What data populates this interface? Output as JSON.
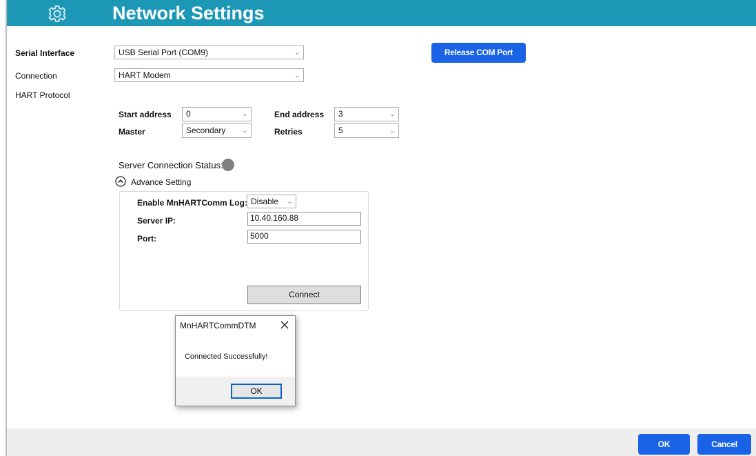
{
  "header": {
    "title": "Network Settings",
    "icon": "gear-icon",
    "bg_color": "#1d97b6"
  },
  "form": {
    "serial_interface_label": "Serial Interface",
    "serial_interface_value": "USB Serial Port (COM9)",
    "connection_label": "Connection",
    "connection_value": "HART Modem",
    "hart_protocol_label": "HART Protocol",
    "release_button": "Release COM Port",
    "start_address_label": "Start address",
    "start_address_value": "0",
    "end_address_label": "End address",
    "end_address_value": "3",
    "master_label": "Master",
    "master_value": "Secondary",
    "retries_label": "Retries",
    "retries_value": "5"
  },
  "status": {
    "label": "Server Connection Status:",
    "dot_color": "#808080"
  },
  "advance": {
    "toggle_label": "Advance Setting",
    "log_label": "Enable MnHARTComm Log:",
    "log_value": "Disable",
    "server_ip_label": "Server IP:",
    "server_ip_value": "10.40.160.88",
    "port_label": "Port:",
    "port_value": "5000",
    "connect_button": "Connect"
  },
  "dialog": {
    "title": "MnHARTCommDTM",
    "message": "Connected Successfully!",
    "ok_button": "OK"
  },
  "footer": {
    "ok_button": "OK",
    "cancel_button": "Cancel",
    "accent": "#1a62e6"
  }
}
